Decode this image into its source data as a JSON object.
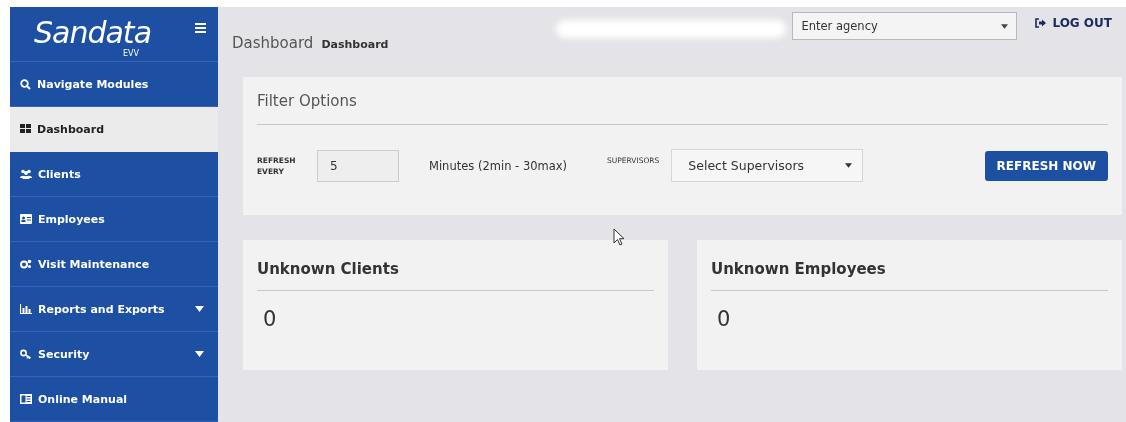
{
  "sidebar": {
    "logo": "Sandata",
    "logo_sub": "EVV",
    "items": [
      {
        "label": "Navigate Modules",
        "selected": false,
        "expandable": false
      },
      {
        "label": "Dashboard",
        "selected": true,
        "expandable": false
      },
      {
        "label": "Clients",
        "selected": false,
        "expandable": false
      },
      {
        "label": "Employees",
        "selected": false,
        "expandable": false
      },
      {
        "label": "Visit Maintenance",
        "selected": false,
        "expandable": false
      },
      {
        "label": "Reports and Exports",
        "selected": false,
        "expandable": true
      },
      {
        "label": "Security",
        "selected": false,
        "expandable": true
      },
      {
        "label": "Online Manual",
        "selected": false,
        "expandable": false
      }
    ]
  },
  "header": {
    "title": "Dashboard",
    "breadcrumb": "Dashboard",
    "agency": {
      "placeholder": "Enter agency"
    },
    "logout": "LOG OUT"
  },
  "filter": {
    "title": "Filter Options",
    "refresh_label": "REFRESH EVERY",
    "refresh_value": "5",
    "minutes_hint": "Minutes (2min - 30max)",
    "supervisors_label": "SUPERVISORS",
    "supervisors_select": "Select Supervisors",
    "refresh_button": "REFRESH NOW"
  },
  "cards": [
    {
      "title": "Unknown Clients",
      "value": "0"
    },
    {
      "title": "Unknown Employees",
      "value": "0"
    }
  ]
}
